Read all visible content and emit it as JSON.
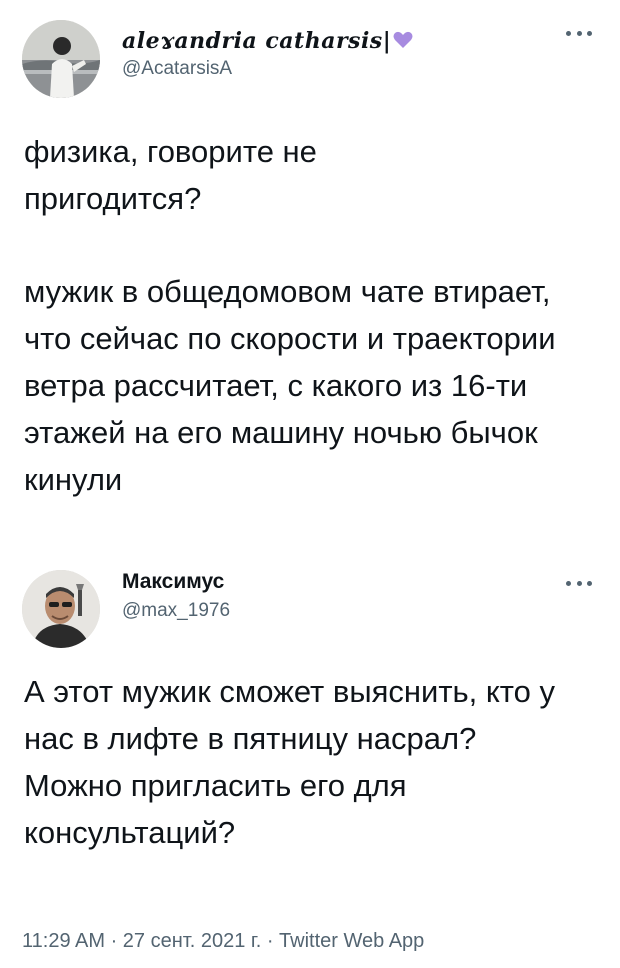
{
  "tweets": [
    {
      "author": {
        "display_name": "aleɤandria catharsis|",
        "handle": "@AcatarsisA",
        "avatar": "avatar-photo",
        "name_icon": "purple-heart-icon"
      },
      "more_icon": "more-horizontal-icon",
      "paragraphs": [
        "физика, говорите не пригодится?",
        "мужик в общедомовом чате втирает, что сейчас по скорости и траектории ветра рассчитает, с какого из 16-ти этажей на его машину ночью бычок кинули"
      ]
    },
    {
      "author": {
        "display_name": "Максимус",
        "handle": "@max_1976",
        "avatar": "avatar-photo"
      },
      "more_icon": "more-horizontal-icon",
      "paragraphs": [
        "А этот мужик сможет выяснить, кто у нас в лифте в пятницу насрал?",
        "Можно пригласить его для консультаций?"
      ],
      "timestamp": "11:29 AM · 27 сент. 2021 г. · Twitter Web App"
    }
  ],
  "colors": {
    "text_primary": "#0f1419",
    "text_secondary": "#536471",
    "heart": "#a78be0",
    "background": "#ffffff"
  }
}
